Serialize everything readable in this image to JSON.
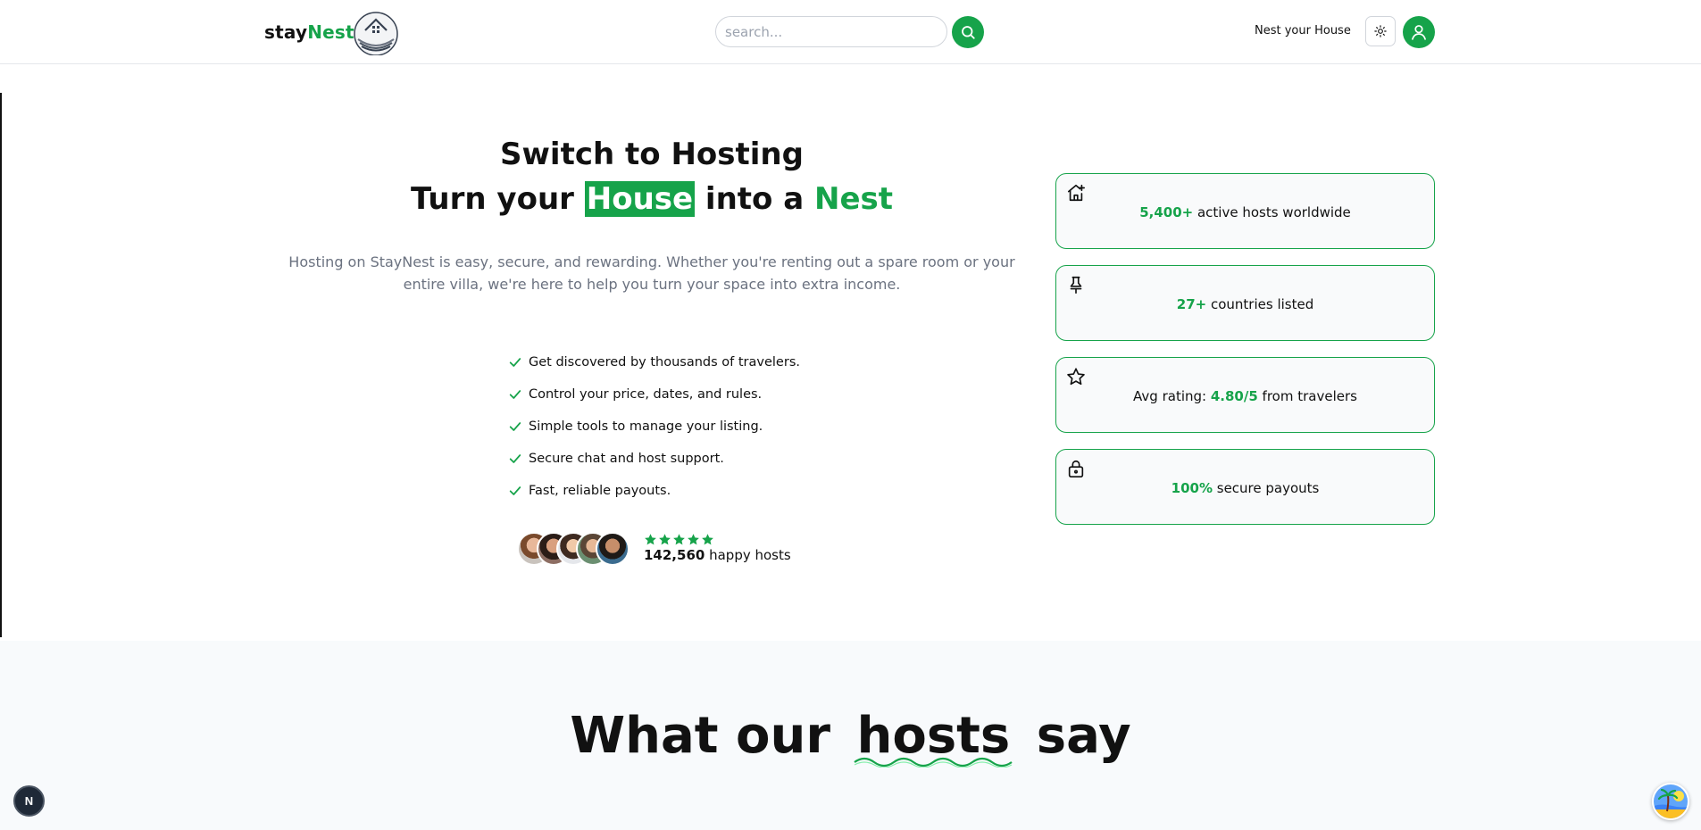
{
  "header": {
    "brand_prefix": "stay",
    "brand_accent": "Nest",
    "logo_icon": "house-nest-logo-icon",
    "search": {
      "placeholder": "search...",
      "value": ""
    },
    "search_icon": "search-icon",
    "nav_link": "Nest your House",
    "theme_icon": "sun-icon",
    "profile_icon": "user-icon"
  },
  "hero": {
    "title_line1": "Switch to Hosting",
    "title_line2_a": "Turn your ",
    "title_line2_highlight": "House",
    "title_line2_b": " into a ",
    "title_line2_accent": "Nest",
    "description": "Hosting on StayNest is easy, secure, and rewarding. Whether you're renting out a spare room or your entire villa, we're here to help you turn your space into extra income.",
    "features": [
      "Get discovered by thousands of travelers.",
      "Control your price, dates, and rules.",
      "Simple tools to manage your listing.",
      "Secure chat and host support.",
      "Fast, reliable payouts."
    ],
    "rating_stars": 5,
    "happy_hosts_count": "142,560",
    "happy_hosts_label": " happy hosts"
  },
  "stats": [
    {
      "icon": "house-plus-icon",
      "num": "5,400+",
      "pre": "",
      "post": " active hosts worldwide"
    },
    {
      "icon": "pin-icon",
      "num": "27+",
      "pre": "",
      "post": " countries listed"
    },
    {
      "icon": "star-icon",
      "num": "4.80/5",
      "pre": "Avg rating: ",
      "post": " from travelers"
    },
    {
      "icon": "lock-icon",
      "num": "100%",
      "pre": "",
      "post": " secure payouts"
    }
  ],
  "testimonials": {
    "title_a": "What our",
    "title_highlight": "hosts",
    "title_b": "say"
  },
  "widgets": {
    "next_badge": "N",
    "chat_icon": "beach-avatar-icon"
  },
  "colors": {
    "accent": "#16a34a",
    "text": "#111111",
    "muted": "#6b7280",
    "card_bg": "#f9fafb"
  }
}
